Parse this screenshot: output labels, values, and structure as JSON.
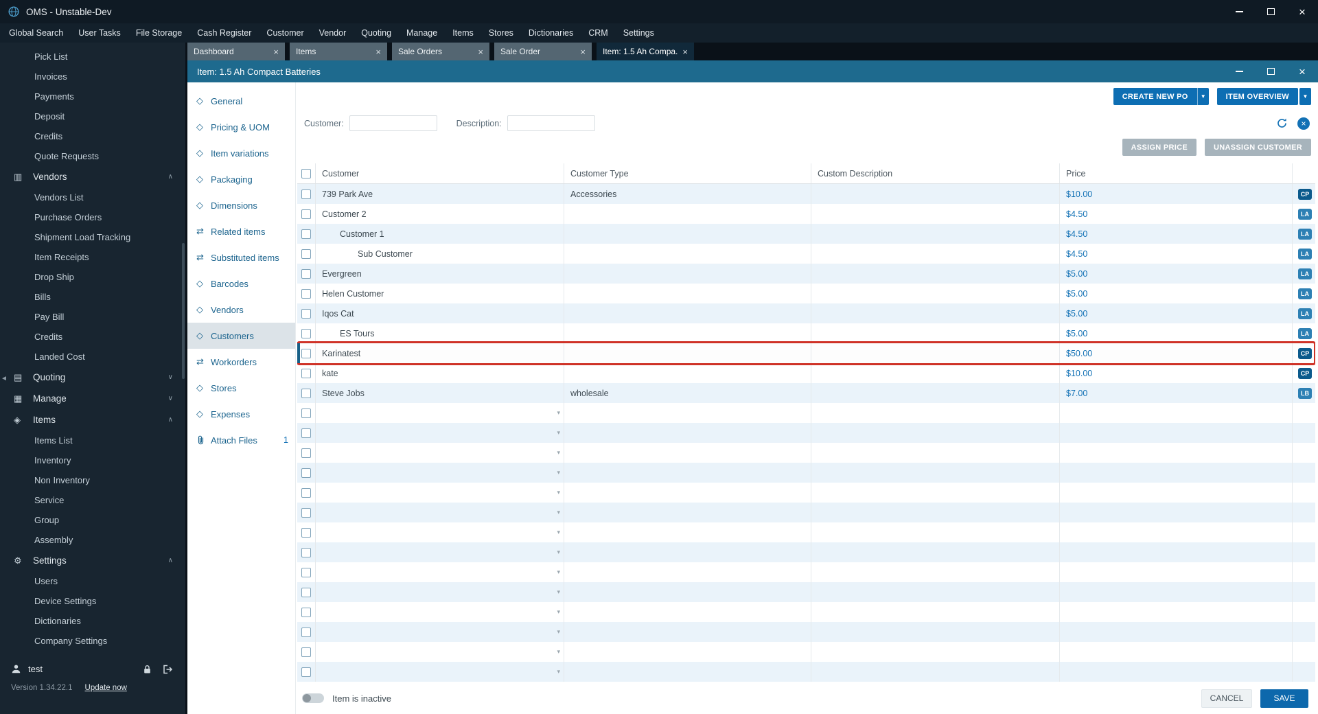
{
  "app": {
    "title": "OMS - Unstable-Dev"
  },
  "menubar": {
    "items": [
      "Global Search",
      "User Tasks",
      "File Storage",
      "Cash Register",
      "Customer",
      "Vendor",
      "Quoting",
      "Manage",
      "Items",
      "Stores",
      "Dictionaries",
      "CRM",
      "Settings"
    ]
  },
  "tabs": [
    {
      "label": "Dashboard",
      "active": false
    },
    {
      "label": "Items",
      "active": false
    },
    {
      "label": "Sale Orders",
      "active": false
    },
    {
      "label": "Sale Order",
      "active": false
    },
    {
      "label": "Item: 1.5 Ah Compa...",
      "active": true
    }
  ],
  "sidebar": {
    "top_items": [
      "Pick List",
      "Invoices",
      "Payments",
      "Deposit",
      "Credits",
      "Quote Requests"
    ],
    "sections": [
      {
        "label": "Vendors",
        "icon": "truck-icon",
        "expanded": true,
        "children": [
          "Vendors List",
          "Purchase Orders",
          "Shipment Load Tracking",
          "Item Receipts",
          "Drop Ship",
          "Bills",
          "Pay Bill",
          "Credits",
          "Landed Cost"
        ]
      },
      {
        "label": "Quoting",
        "icon": "quote-icon",
        "expanded": false,
        "children": []
      },
      {
        "label": "Manage",
        "icon": "manage-icon",
        "expanded": false,
        "children": []
      },
      {
        "label": "Items",
        "icon": "items-icon",
        "expanded": true,
        "children": [
          "Items List",
          "Inventory",
          "Non Inventory",
          "Service",
          "Group",
          "Assembly"
        ]
      },
      {
        "label": "Settings",
        "icon": "settings-icon",
        "expanded": true,
        "children": [
          "Users",
          "Device Settings",
          "Dictionaries",
          "Company Settings"
        ]
      }
    ],
    "user": {
      "name": "test",
      "version": "Version 1.34.22.1",
      "update_link": "Update now"
    }
  },
  "window": {
    "title": "Item: 1.5 Ah Compact Batteries",
    "nav": [
      {
        "label": "General",
        "icon": "diamond-icon"
      },
      {
        "label": "Pricing & UOM",
        "icon": "diamond-icon"
      },
      {
        "label": "Item variations",
        "icon": "diamond-icon"
      },
      {
        "label": "Packaging",
        "icon": "diamond-icon"
      },
      {
        "label": "Dimensions",
        "icon": "diamond-icon"
      },
      {
        "label": "Related items",
        "icon": "exchange-icon"
      },
      {
        "label": "Substituted items",
        "icon": "exchange-icon"
      },
      {
        "label": "Barcodes",
        "icon": "diamond-icon"
      },
      {
        "label": "Vendors",
        "icon": "diamond-icon"
      },
      {
        "label": "Customers",
        "icon": "diamond-icon",
        "selected": true
      },
      {
        "label": "Workorders",
        "icon": "exchange-icon"
      },
      {
        "label": "Stores",
        "icon": "diamond-icon"
      },
      {
        "label": "Expenses",
        "icon": "diamond-icon"
      },
      {
        "label": "Attach Files",
        "icon": "paperclip-icon",
        "badge": "1"
      }
    ],
    "toolbar": {
      "create_new_po": "CREATE NEW PO",
      "item_overview": "ITEM OVERVIEW"
    },
    "filters": {
      "customer_label": "Customer:",
      "customer_value": "",
      "description_label": "Description:",
      "description_value": ""
    },
    "actions": {
      "assign_price": "ASSIGN PRICE",
      "unassign_customer": "UNASSIGN CUSTOMER"
    },
    "table": {
      "columns": [
        "Customer",
        "Customer Type",
        "Custom Description",
        "Price"
      ],
      "rows": [
        {
          "customer": "739 Park Ave",
          "type": "Accessories",
          "desc": "",
          "price": "$10.00",
          "badge": "CP",
          "indent": 0
        },
        {
          "customer": "Customer 2",
          "type": "",
          "desc": "",
          "price": "$4.50",
          "badge": "LA",
          "indent": 0
        },
        {
          "customer": "Customer 1",
          "type": "",
          "desc": "",
          "price": "$4.50",
          "badge": "LA",
          "indent": 1
        },
        {
          "customer": "Sub Customer",
          "type": "",
          "desc": "",
          "price": "$4.50",
          "badge": "LA",
          "indent": 2
        },
        {
          "customer": "Evergreen",
          "type": "",
          "desc": "",
          "price": "$5.00",
          "badge": "LA",
          "indent": 0
        },
        {
          "customer": "Helen Customer",
          "type": "",
          "desc": "",
          "price": "$5.00",
          "badge": "LA",
          "indent": 0
        },
        {
          "customer": "Iqos Cat",
          "type": "",
          "desc": "",
          "price": "$5.00",
          "badge": "LA",
          "indent": 0
        },
        {
          "customer": "ES Tours",
          "type": "",
          "desc": "",
          "price": "$5.00",
          "badge": "LA",
          "indent": 1
        },
        {
          "customer": "Karinatest",
          "type": "",
          "desc": "",
          "price": "$50.00",
          "badge": "CP",
          "indent": 0,
          "highlighted": true
        },
        {
          "customer": "kate",
          "type": "",
          "desc": "",
          "price": "$10.00",
          "badge": "CP",
          "indent": 0
        },
        {
          "customer": "Steve Jobs",
          "type": "wholesale",
          "desc": "",
          "price": "$7.00",
          "badge": "LB",
          "indent": 0
        }
      ],
      "empty_row_count": 14
    },
    "footer": {
      "inactive_label": "Item is inactive",
      "inactive_on": false,
      "cancel": "CANCEL",
      "save": "SAVE"
    }
  },
  "colors": {
    "accent_blue": "#0d6eb3",
    "badge_cp": "#0b5a8c",
    "badge_la": "#2d80b4",
    "badge_lb": "#2d80b4",
    "highlight_red": "#cf3227",
    "row_alt": "#eaf3fa"
  }
}
